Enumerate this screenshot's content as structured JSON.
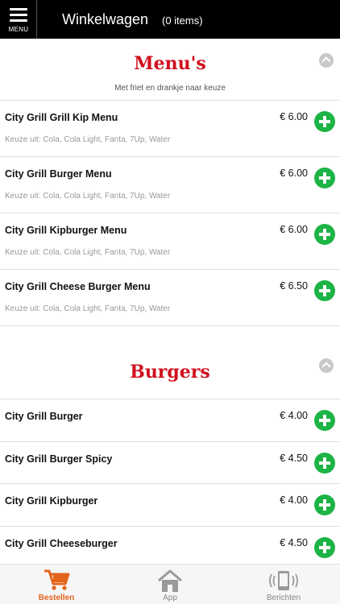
{
  "header": {
    "menu_label": "MENU",
    "title": "Winkelwagen",
    "item_count": "(0 items)"
  },
  "sections": [
    {
      "title": "Menu's",
      "subtitle": "Met friet en drankje naar keuze",
      "items": [
        {
          "name": "City Grill Grill Kip Menu",
          "price": "€ 6.00",
          "desc": "Keuze uit: Cola, Cola Light, Fanta, 7Up, Water"
        },
        {
          "name": "City Grill Burger Menu",
          "price": "€ 6.00",
          "desc": "Keuze uit: Cola, Cola Light, Fanta, 7Up, Water"
        },
        {
          "name": "City Grill Kipburger Menu",
          "price": "€ 6.00",
          "desc": "Keuze uit: Cola, Cola Light, Fanta, 7Up, Water"
        },
        {
          "name": "City Grill Cheese Burger Menu",
          "price": "€ 6.50",
          "desc": "Keuze uit: Cola, Cola Light, Fanta, 7Up, Water"
        }
      ]
    },
    {
      "title": "Burgers",
      "items": [
        {
          "name": "City Grill Burger",
          "price": "€ 4.00"
        },
        {
          "name": "City Grill Burger Spicy",
          "price": "€ 4.50"
        },
        {
          "name": "City Grill Kipburger",
          "price": "€ 4.00"
        },
        {
          "name": "City Grill Cheeseburger",
          "price": "€ 4.50"
        }
      ]
    }
  ],
  "tabs": [
    {
      "label": "Bestellen",
      "icon": "cart-icon",
      "active": true
    },
    {
      "label": "App",
      "icon": "home-icon",
      "active": false
    },
    {
      "label": "Berichten",
      "icon": "phone-vibrate-icon",
      "active": false
    }
  ],
  "colors": {
    "accent_red": "#d0101e",
    "add_green": "#1db446",
    "active_tab": "#e3651d"
  }
}
